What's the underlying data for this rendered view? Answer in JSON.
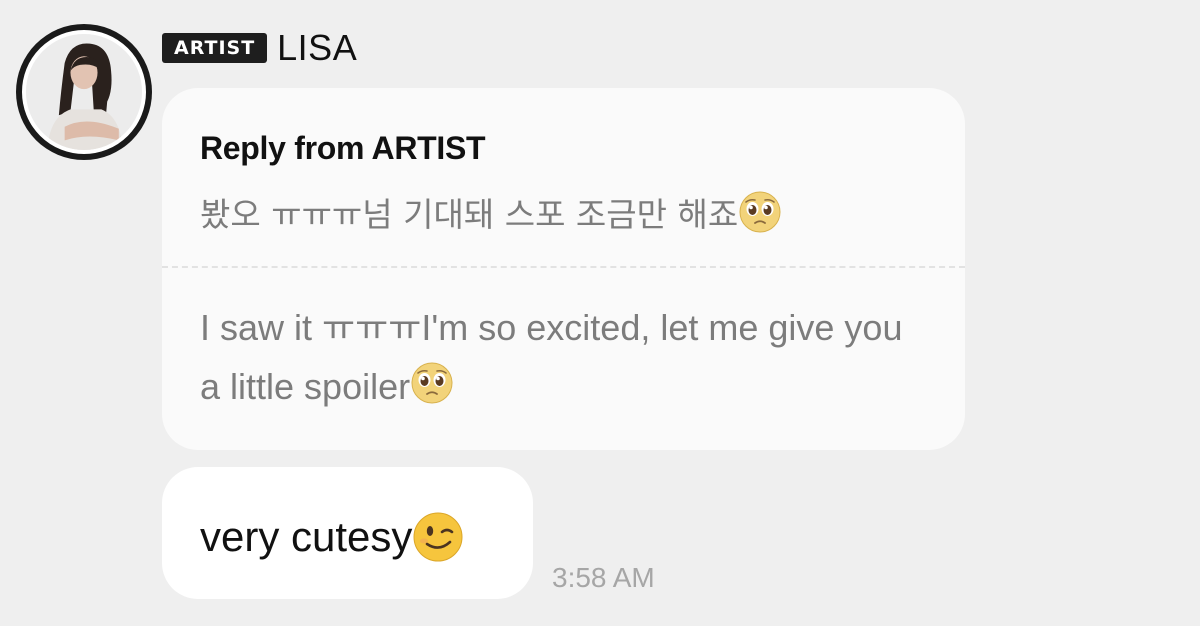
{
  "sender": {
    "badge": "ARTIST",
    "name": "LISA"
  },
  "reply": {
    "header": "Reply from ARTIST",
    "original_text": "봤오 ㅠㅠㅠ넘 기대돼 스포 조금만 해죠",
    "original_emoji": "pleading-face-emoji",
    "translation_text": "I saw it ㅠㅠㅠI'm so excited, let me give you a little spoiler",
    "translation_emoji": "pleading-face-emoji"
  },
  "message": {
    "text": "very cutesy",
    "emoji": "winking-face-emoji",
    "time": "3:58 AM"
  },
  "colors": {
    "background": "#efefef",
    "bubble": "#ffffff",
    "reply_bubble": "#fafafa",
    "badge": "#1e1e1e",
    "muted_text": "#7c7c7c",
    "timestamp": "#a6a6a6"
  }
}
